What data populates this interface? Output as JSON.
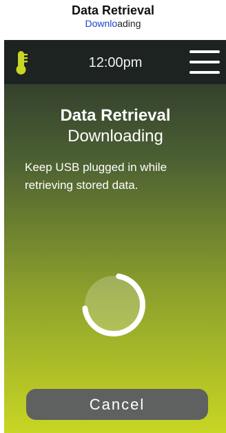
{
  "caption": {
    "title": "Data Retrieval",
    "subtitle_highlight": "Downlo",
    "subtitle_rest": "ading"
  },
  "status_bar": {
    "time": "12:00pm",
    "left_icon": "thermometer-icon",
    "right_icon": "hamburger-menu-icon"
  },
  "screen": {
    "title": "Data Retrieval",
    "subtitle": "Downloading",
    "message": "Keep USB plugged in while retrieving stored data.",
    "progress_indicator": "loading-spinner"
  },
  "actions": {
    "cancel_label": "Cancel"
  },
  "colors": {
    "accent": "#c8d624",
    "status_bar_bg": "#1d2320",
    "gradient_top": "#27302a",
    "gradient_bottom": "#c8d624",
    "button_bg": "#5e6160",
    "caption_highlight": "#1a3fd0"
  }
}
